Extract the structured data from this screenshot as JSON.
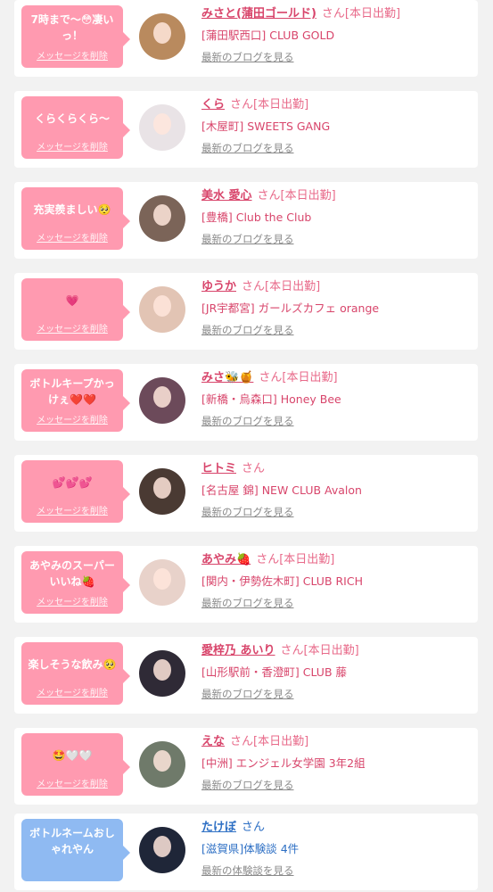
{
  "delete_label": "メッセージを削除",
  "cards": [
    {
      "message": "7時まで〜😳凄いっ！",
      "name": "みさと(蒲田ゴールド)",
      "suffix": "さん[本日出勤]",
      "shop": "[蒲田駅西口] CLUB GOLD",
      "link": "最新のブログを見る",
      "theme": "pink",
      "avatar_color": "#b98a5e"
    },
    {
      "message": "くらくらくら〜",
      "name": "くら",
      "suffix": "さん[本日出勤]",
      "shop": "[木屋町] SWEETS GANG",
      "link": "最新のブログを見る",
      "theme": "pink",
      "avatar_color": "#e9e3e6"
    },
    {
      "message": "充実羨ましい🥺",
      "name": "美水 愛心",
      "suffix": "さん[本日出勤]",
      "shop": "[豊橋] Club the Club",
      "link": "最新のブログを見る",
      "theme": "pink",
      "avatar_color": "#7b6458"
    },
    {
      "message": "💗",
      "name": "ゆうか",
      "suffix": "さん[本日出勤]",
      "shop": "[JR宇都宮] ガールズカフェ orange",
      "link": "最新のブログを見る",
      "theme": "pink",
      "avatar_color": "#e2c4b4"
    },
    {
      "message": "ボトルキープかっけぇ❤️❤️",
      "name": "みさ🐝🍯",
      "suffix": "さん[本日出勤]",
      "shop": "[新橋・烏森口] Honey Bee",
      "link": "最新のブログを見る",
      "theme": "pink",
      "avatar_color": "#6c4a5a"
    },
    {
      "message": "💕💕💕",
      "name": "ヒトミ",
      "suffix": "さん",
      "shop": "[名古屋 錦] NEW CLUB Avalon",
      "link": "最新のブログを見る",
      "theme": "pink",
      "avatar_color": "#4a3a33"
    },
    {
      "message": "あやみのスーパーいいね🍓",
      "name": "あやみ🍓",
      "suffix": "さん[本日出勤]",
      "shop": "[関内・伊勢佐木町] CLUB RICH",
      "link": "最新のブログを見る",
      "theme": "pink",
      "avatar_color": "#e8d2ca"
    },
    {
      "message": "楽しそうな飲み🥺",
      "name": "愛梓乃 あいり",
      "suffix": "さん[本日出勤]",
      "shop": "[山形駅前・香澄町] CLUB 藤",
      "link": "最新のブログを見る",
      "theme": "pink",
      "avatar_color": "#2f2a36"
    },
    {
      "message": "🤩🤍🤍",
      "name": "えな",
      "suffix": "さん[本日出勤]",
      "shop": "[中洲] エンジェル女学園 3年2組",
      "link": "最新のブログを見る",
      "theme": "pink",
      "avatar_color": "#6f7a6a"
    },
    {
      "message": "ボトルネームおしゃれやん",
      "name": "たけぼ",
      "suffix": "さん",
      "shop": "[滋賀県]体験談 4件",
      "link": "最新の体験談を見る",
      "theme": "blue",
      "avatar_color": "#1f2638"
    }
  ]
}
